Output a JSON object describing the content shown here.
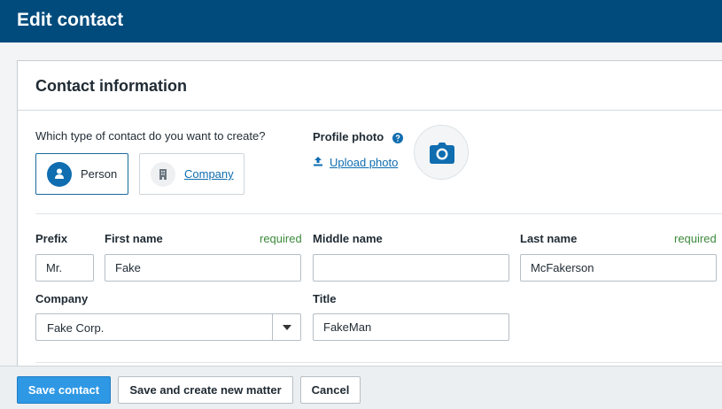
{
  "header": {
    "title": "Edit contact"
  },
  "card": {
    "title": "Contact information"
  },
  "contact_type": {
    "question": "Which type of contact do you want to create?",
    "person_label": "Person",
    "company_label": "Company",
    "selected": "Person"
  },
  "profile_photo": {
    "label": "Profile photo",
    "upload_label": "Upload photo",
    "icons": [
      "help-icon",
      "upload-icon",
      "camera-icon"
    ]
  },
  "fields": {
    "prefix": {
      "label": "Prefix",
      "value": "Mr."
    },
    "first_name": {
      "label": "First name",
      "required": "required",
      "value": "Fake"
    },
    "middle_name": {
      "label": "Middle name",
      "value": ""
    },
    "last_name": {
      "label": "Last name",
      "required": "required",
      "value": "McFakerson"
    },
    "company": {
      "label": "Company",
      "value": "Fake Corp."
    },
    "title": {
      "label": "Title",
      "value": "FakeMan"
    }
  },
  "footer": {
    "save_label": "Save contact",
    "save_new_matter_label": "Save and create new matter",
    "cancel_label": "Cancel"
  },
  "colors": {
    "header_bg": "#004b7c",
    "accent": "#0f6db0",
    "primary_button": "#2e98e5",
    "required_text": "#3c8a3c"
  }
}
